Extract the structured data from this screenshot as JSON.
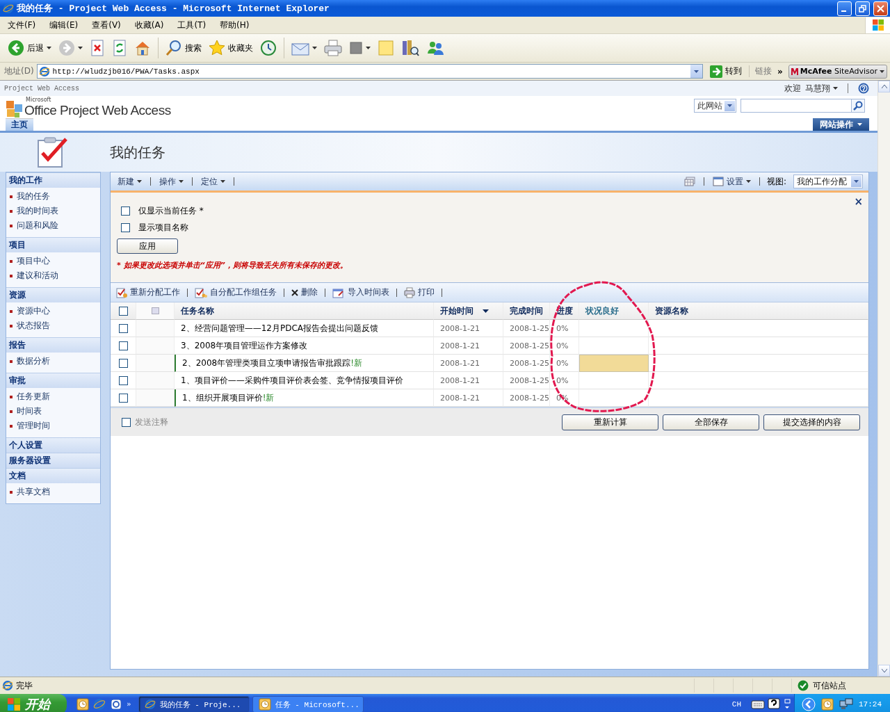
{
  "window": {
    "title": "我的任务 - Project Web Access - Microsoft Internet Explorer"
  },
  "menu": [
    "文件(F)",
    "编辑(E)",
    "查看(V)",
    "收藏(A)",
    "工具(T)",
    "帮助(H)"
  ],
  "browser_toolbar": {
    "back": "后退",
    "search": "搜索",
    "favorites": "收藏夹"
  },
  "address_bar": {
    "label": "地址(D)",
    "url": "http://wludzjb016/PWA/Tasks.aspx",
    "go": "转到",
    "links": "链接",
    "chevron": "»",
    "addon": "**McAfee** SiteAdvisor"
  },
  "site": {
    "app_name": "Project Web Access",
    "welcome": "欢迎",
    "user": "马慧翔",
    "logo_small": "Microsoft",
    "logo": "Office Project Web Access",
    "search_scope": "此网站",
    "tabs": [
      {
        "label": "主页",
        "selected": true
      }
    ],
    "site_actions": "网站操作"
  },
  "page_title": "我的任务",
  "sidebar": [
    {
      "heading": "我的工作",
      "items": [
        "我的任务",
        "我的时间表",
        "问题和风险"
      ]
    },
    {
      "heading": "项目",
      "items": [
        "项目中心",
        "建议和活动"
      ]
    },
    {
      "heading": "资源",
      "items": [
        "资源中心",
        "状态报告"
      ]
    },
    {
      "heading": "报告",
      "items": [
        "数据分析"
      ]
    },
    {
      "heading": "审批",
      "items": [
        "任务更新",
        "时间表",
        "管理时间"
      ]
    },
    {
      "heading": "个人设置"
    },
    {
      "heading": "服务器设置"
    },
    {
      "heading": "文档",
      "items": [
        "共享文档"
      ]
    }
  ],
  "panel_toolbar": {
    "menus": [
      "新建",
      "操作",
      "定位"
    ],
    "settings": "设置",
    "view_label": "视图:",
    "view": "我的工作分配"
  },
  "options": {
    "close": "×",
    "items": [
      {
        "label": "仅显示当前任务 *",
        "checked": false
      },
      {
        "label": "显示项目名称",
        "checked": false
      }
    ],
    "apply": "应用",
    "warning": "* 如果更改此选项并单击“应用”，则将导致丢失所有未保存的更改。"
  },
  "actions": [
    "重新分配工作",
    "自分配工作组任务",
    "删除",
    "导入时间表",
    "打印"
  ],
  "table": {
    "select_all_checked": false,
    "columns": [
      "任务名称",
      "开始时间",
      "完成时间",
      "进度",
      "状况良好",
      "资源名称"
    ],
    "rows": [
      {
        "checked": false,
        "name": "2、经营问题管理——12月PDCA报告会提出问题反馈",
        "start": "2008-1-21",
        "finish": "2008-1-25",
        "progress": "0%",
        "status_highlight": false
      },
      {
        "checked": false,
        "name": "3、2008年项目管理运作方案修改",
        "start": "2008-1-21",
        "finish": "2008-1-25",
        "progress": "0%",
        "status_highlight": false
      },
      {
        "checked": false,
        "name": "2、2008年管理类项目立项申请报告审批跟踪",
        "flag": "!新",
        "start": "2008-1-21",
        "finish": "2008-1-25",
        "progress": "0%",
        "status_highlight": true
      },
      {
        "checked": false,
        "name": "1、项目评价——采购件项目评价表会签、竞争情报项目评价",
        "start": "2008-1-21",
        "finish": "2008-1-25",
        "progress": "0%",
        "status_highlight": false
      },
      {
        "checked": false,
        "name": "1、组织开展项目评价",
        "flag": "!新",
        "start": "2008-1-21",
        "finish": "2008-1-25",
        "progress": "0%",
        "status_highlight": false
      }
    ]
  },
  "footer": {
    "send_comments": {
      "label": "发送注释",
      "checked": false,
      "disabled": true
    },
    "buttons": [
      "重新计算",
      "全部保存",
      "提交选择的内容"
    ]
  },
  "status_bar": {
    "text": "完毕",
    "zone": "可信站点"
  },
  "taskbar": {
    "start": "开始",
    "chevron": "»",
    "windows": [
      {
        "label": "我的任务 - Proje...",
        "selected": true
      },
      {
        "label": "任务 - Microsoft...",
        "selected": false
      }
    ],
    "lang": "CH",
    "time": "17:24"
  }
}
